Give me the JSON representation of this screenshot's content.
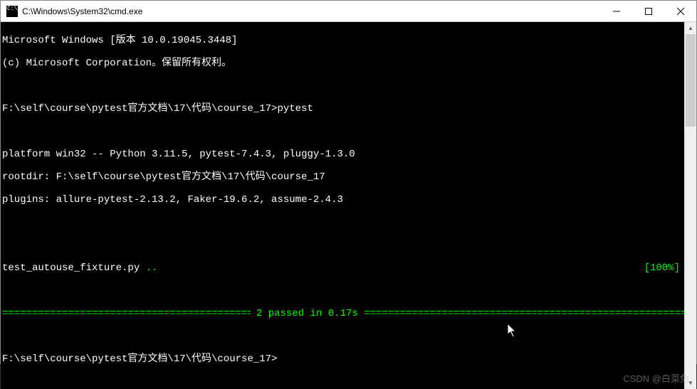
{
  "window": {
    "title": "C:\\Windows\\System32\\cmd.exe"
  },
  "terminal": {
    "banner1": "Microsoft Windows [版本 10.0.19045.3448]",
    "banner2": "(c) Microsoft Corporation。保留所有权利。",
    "prompt1_path": "F:\\self\\course\\pytest官方文档\\17\\代码\\course_17>",
    "prompt1_cmd": "pytest",
    "platform": "platform win32 -- Python 3.11.5, pytest-7.4.3, pluggy-1.3.0",
    "rootdir": "rootdir: F:\\self\\course\\pytest官方文档\\17\\代码\\course_17",
    "plugins": "plugins: allure-pytest-2.13.2, Faker-19.6.2, assume-2.4.3",
    "testfile": "test_autouse_fixture.py ",
    "dots": "..",
    "progress": "[100%]",
    "summary": "2 passed in 0.17s",
    "eqline_left": "=======================================================",
    "eqline_right": "=======================================================================",
    "prompt2": "F:\\self\\course\\pytest官方文档\\17\\代码\\course_17>"
  },
  "watermark": "CSDN @白菜兔"
}
